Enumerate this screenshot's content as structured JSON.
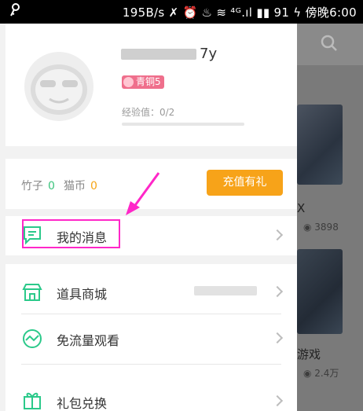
{
  "status_bar": {
    "text": "195B/s ✗ ⏰ ♨ ≋ ⁴ᴳ.ıl ▮▮ 91 ϟ 傍晚6:00"
  },
  "background": {
    "title_fragment_1": "X",
    "views_1": "◉ 3898",
    "title_fragment_2": "游戏",
    "views_2": "◉ 2.4万"
  },
  "profile": {
    "username_suffix": "7y",
    "level_badge": "青铜5",
    "exp_label": "经验值：0/2",
    "exp_fraction": 0
  },
  "wallet": {
    "bamboo_label": "竹子",
    "bamboo_value": "0",
    "catcoin_label": "猫币",
    "catcoin_value": "0",
    "recharge_button": "充值有礼"
  },
  "menu": {
    "messages": "我的消息",
    "shop": "道具商城",
    "free_data": "免流量观看",
    "gift_exchange": "礼包兑换"
  },
  "colors": {
    "accent_green": "#2bc98a",
    "recharge_orange": "#f7a319",
    "highlight_magenta": "#ff27c8"
  }
}
